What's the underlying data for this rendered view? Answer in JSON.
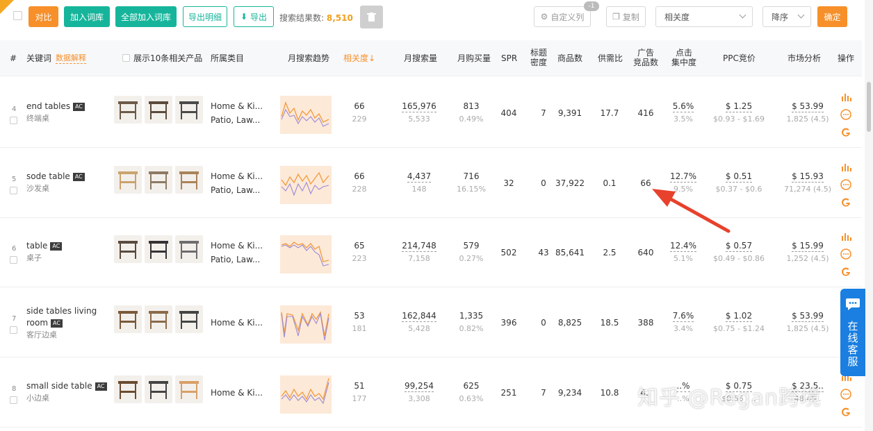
{
  "toolbar": {
    "compare": "对比",
    "add_library": "加入词库",
    "add_all_library": "全部加入词库",
    "export_detail": "导出明细",
    "export": "导出",
    "result_label": "搜索结果数:",
    "result_count": "8,510",
    "custom_columns": "自定义列",
    "custom_badge": "-1",
    "copy": "复制",
    "sort_field": "相关度",
    "sort_order": "降序",
    "confirm": "确定"
  },
  "header": {
    "idx": "#",
    "keyword": "关键词",
    "data_explain": "数据解释",
    "show_products": "展示10条相关产品",
    "category": "所属类目",
    "trend": "月搜索趋势",
    "relevance": "相关度↓",
    "monthly_search": "月搜索量",
    "monthly_buy": "月购买量",
    "spr": "SPR",
    "title_density_1": "标题",
    "title_density_2": "密度",
    "products": "商品数",
    "supply_ratio": "供需比",
    "ad_products_1": "广告",
    "ad_products_2": "竞品数",
    "click_conc_1": "点击",
    "click_conc_2": "集中度",
    "ppc": "PPC竞价",
    "market": "市场分析",
    "ops": "操作"
  },
  "rows": [
    {
      "idx": "4",
      "kw": "end tables",
      "kw2": "",
      "ac": "AC",
      "cn": "终端桌",
      "cat1": "Home & Ki...",
      "cat2": "Patio, Law...",
      "rel": "66",
      "rel_sub": "229",
      "ms": "165,976",
      "ms_sub": "5,533",
      "mb": "813",
      "mb_sub": "0.49%",
      "spr": "404",
      "td": "7",
      "pc": "9,391",
      "sr": "17.7",
      "ad": "416",
      "cc": "5.6%",
      "cc_sub": "3.5%",
      "ppc": "$ 1.25",
      "ppc_sub": "$0.93 - $1.69",
      "mk": "$ 53.99",
      "mk_sub": "1,825 (4.5)"
    },
    {
      "idx": "5",
      "kw": "sode table",
      "kw2": "",
      "ac": "AC",
      "cn": "沙发桌",
      "cat1": "Home & Ki...",
      "cat2": "Patio, Law...",
      "rel": "66",
      "rel_sub": "228",
      "ms": "4,437",
      "ms_sub": "148",
      "mb": "716",
      "mb_sub": "16.15%",
      "spr": "32",
      "td": "0",
      "pc": "37,922",
      "sr": "0.1",
      "ad": "66",
      "cc": "12.7%",
      "cc_sub": "9.5%",
      "ppc": "$ 0.51",
      "ppc_sub": "$0.37 - $0.6",
      "mk": "$ 15.93",
      "mk_sub": "71,274 (4.5)"
    },
    {
      "idx": "6",
      "kw": "table",
      "kw2": "",
      "ac": "AC",
      "cn": "桌子",
      "cat1": "Home & Ki...",
      "cat2": "Patio, Law...",
      "rel": "65",
      "rel_sub": "223",
      "ms": "214,748",
      "ms_sub": "7,158",
      "mb": "579",
      "mb_sub": "0.27%",
      "spr": "502",
      "td": "43",
      "pc": "85,641",
      "sr": "2.5",
      "ad": "640",
      "cc": "12.4%",
      "cc_sub": "5.1%",
      "ppc": "$ 0.57",
      "ppc_sub": "$0.49 - $0.86",
      "mk": "$ 15.99",
      "mk_sub": "1,252 (4.5)"
    },
    {
      "idx": "7",
      "kw": "side tables living",
      "kw2": "room",
      "ac": "AC",
      "cn": "客厅边桌",
      "cat1": "Home & Ki...",
      "cat2": "",
      "rel": "53",
      "rel_sub": "181",
      "ms": "162,844",
      "ms_sub": "5,428",
      "mb": "1,335",
      "mb_sub": "0.82%",
      "spr": "396",
      "td": "0",
      "pc": "8,825",
      "sr": "18.5",
      "ad": "388",
      "cc": "7.6%",
      "cc_sub": "3.4%",
      "ppc": "$ 1.02",
      "ppc_sub": "$0.75 - $1.24",
      "mk": "$ 53.99",
      "mk_sub": "1,825 (4.5)"
    },
    {
      "idx": "8",
      "kw": "small side table",
      "kw2": "",
      "ac": "AC",
      "cn": "小边桌",
      "cat1": "Home & Ki...",
      "cat2": "",
      "rel": "51",
      "rel_sub": "177",
      "ms": "99,254",
      "ms_sub": "3,308",
      "mb": "625",
      "mb_sub": "0.63%",
      "spr": "251",
      "td": "7",
      "pc": "9,234",
      "sr": "10.8",
      "ad": "4..",
      "cc": "..%",
      "cc_sub": "..%",
      "ppc": "$ 0.75",
      "ppc_sub": "$0.56 - ..",
      "mk": "$ 23.5..",
      "mk_sub": "48,45.."
    }
  ],
  "service_label": "在线客服",
  "watermark": "知乎 @Regan跨境",
  "colors": {
    "orange": "#f7902a",
    "teal": "#16b59b",
    "blue": "#1a7fe0",
    "arrow": "#e8412c"
  }
}
